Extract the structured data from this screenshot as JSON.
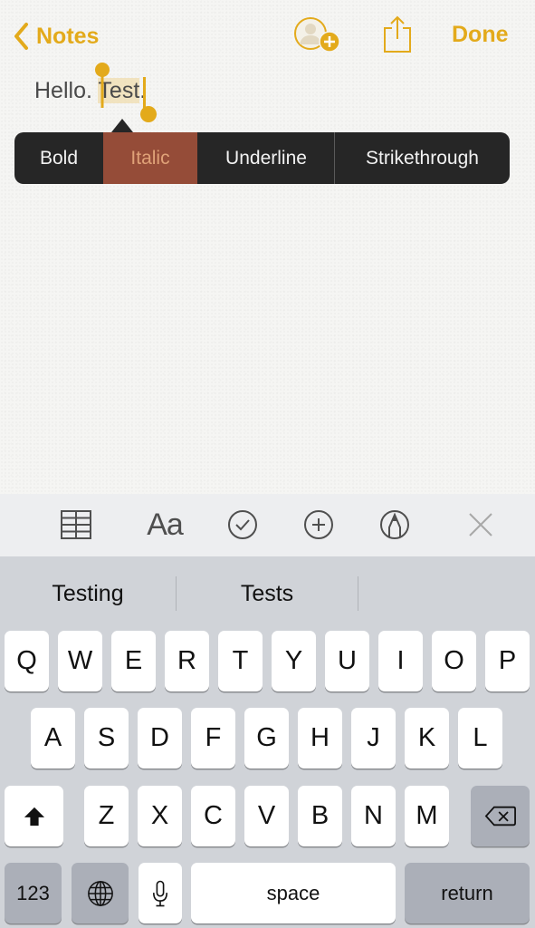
{
  "nav": {
    "back_label": "Notes",
    "done_label": "Done",
    "icons": [
      "chevron-left-icon",
      "add-person-icon",
      "share-icon"
    ]
  },
  "note": {
    "text_before": "Hello. ",
    "selected_text": "Test",
    "text_after": "."
  },
  "context_menu": {
    "items": [
      {
        "label": "Bold"
      },
      {
        "label": "Italic",
        "active": true
      },
      {
        "label": "Underline"
      },
      {
        "label": "Strikethrough"
      }
    ]
  },
  "toolbar": {
    "format_label": "Aa",
    "icons": [
      "table-icon",
      "text-format-icon",
      "checklist-icon",
      "add-icon",
      "sketch-icon",
      "close-icon"
    ]
  },
  "keyboard": {
    "suggestions": [
      "Testing",
      "Tests",
      ""
    ],
    "row1": [
      "Q",
      "W",
      "E",
      "R",
      "T",
      "Y",
      "U",
      "I",
      "O",
      "P"
    ],
    "row2": [
      "A",
      "S",
      "D",
      "F",
      "G",
      "H",
      "J",
      "K",
      "L"
    ],
    "row3": [
      "Z",
      "X",
      "C",
      "V",
      "B",
      "N",
      "M"
    ],
    "numbers_label": "123",
    "space_label": "space",
    "return_label": "return"
  },
  "colors": {
    "accent": "#e3aa1b",
    "menu_bg": "#262626",
    "menu_active": "#954c38",
    "keyboard_bg": "#d0d3d8"
  }
}
